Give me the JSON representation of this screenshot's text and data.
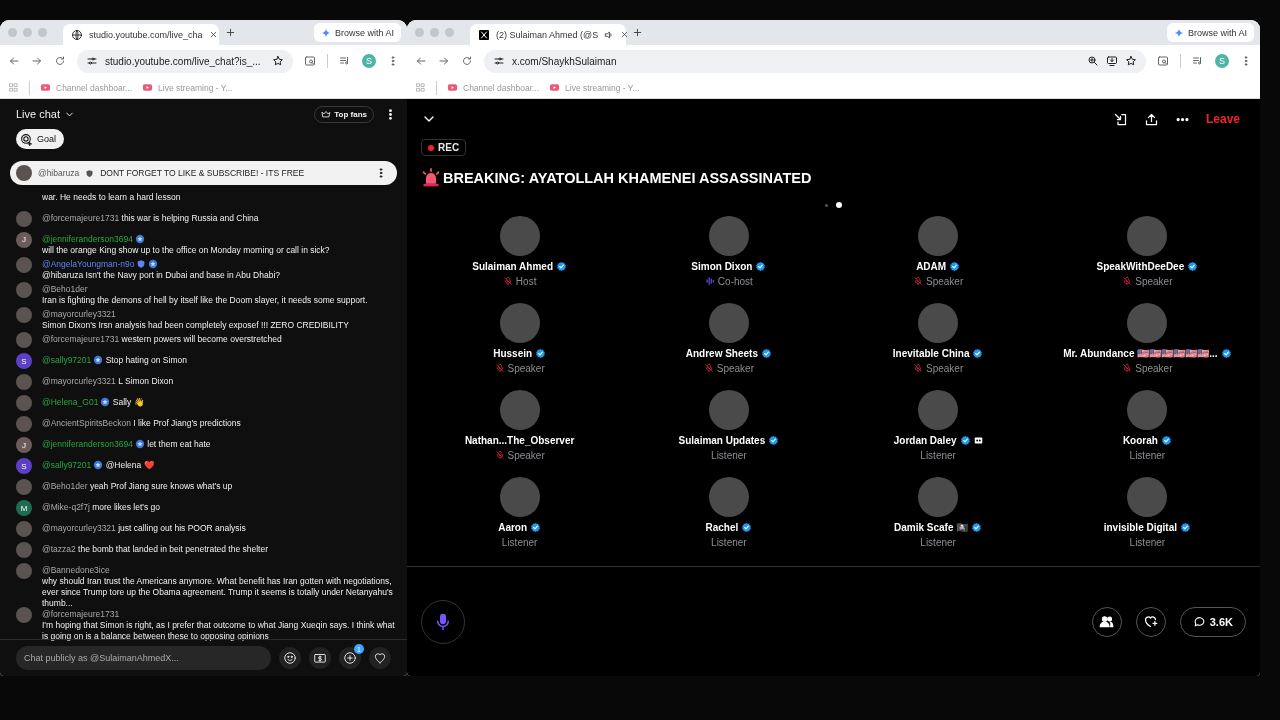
{
  "left_window": {
    "tab": {
      "kind": "globe",
      "title": "studio.youtube.com/live_cha",
      "audio": false
    },
    "browse_ai": "Browse with AI",
    "url": "studio.youtube.com/live_chat?is_...",
    "url_actions": [
      {
        "kind": "star"
      }
    ],
    "profile": "S",
    "bookmarks": [
      "Channel dashboar...",
      "Live streaming - Y..."
    ]
  },
  "live_chat": {
    "title": "Live chat",
    "top_fans": "Top fans",
    "goal": "Goal",
    "pinned": {
      "author": "@hibaruza",
      "text": "DONT FORGET TO LIKE & SUBSCRIBE! - ITS FREE"
    },
    "messages": [
      {
        "kind": "continuation",
        "text": "war. He needs to learn a hard lesson"
      },
      {
        "kind": "message",
        "avatar": {
          "kind": "photo"
        },
        "author": "@forcemajeure1731",
        "moderator": false,
        "member": false,
        "text": "this war is helping Russia and China"
      },
      {
        "kind": "message",
        "avatar": {
          "kind": "letter",
          "letter": "J",
          "color": "#6d5a5a"
        },
        "author": "@jenniferanderson3694",
        "moderator": false,
        "member": true,
        "text": "will the orange King show up to the office on Monday morning or call in sick?"
      },
      {
        "kind": "message",
        "avatar": {
          "kind": "photo"
        },
        "author": "@AngelaYoungman-n9o",
        "moderator": true,
        "member": true,
        "text": "@hibaruza Isn't the Navy port in Dubai and base in Abu Dhabi?"
      },
      {
        "kind": "message",
        "avatar": {
          "kind": "photo"
        },
        "author": "@Beho1der",
        "moderator": false,
        "member": false,
        "text": "Iran is fighting the demons of hell by itself like the Doom slayer, it needs some support."
      },
      {
        "kind": "message",
        "avatar": {
          "kind": "photo"
        },
        "author": "@mayorcurley3321",
        "moderator": false,
        "member": false,
        "text": "Simon Dixon's Irsn analysis had been completely exposef !!! ZERO CREDIBILITY"
      },
      {
        "kind": "message",
        "avatar": {
          "kind": "photo"
        },
        "author": "@forcemajeure1731",
        "moderator": false,
        "member": false,
        "text": "western powers will become overstretched"
      },
      {
        "kind": "message",
        "avatar": {
          "kind": "letter",
          "letter": "S",
          "color": "#5b3fc4"
        },
        "author": "@sally97201",
        "moderator": false,
        "member": true,
        "text": "Stop hating on Simon"
      },
      {
        "kind": "message",
        "avatar": {
          "kind": "photo"
        },
        "author": "@mayorcurley3321",
        "moderator": false,
        "member": false,
        "text": "L Simon Dixon"
      },
      {
        "kind": "message",
        "avatar": {
          "kind": "photo"
        },
        "author": "@Helena_G01",
        "moderator": false,
        "member": true,
        "text": "Sally 👋"
      },
      {
        "kind": "message",
        "avatar": {
          "kind": "photo"
        },
        "author": "@AncientSpiritsBeckon",
        "moderator": false,
        "member": false,
        "text": "I like Prof Jiang's predictions"
      },
      {
        "kind": "message",
        "avatar": {
          "kind": "letter",
          "letter": "J",
          "color": "#6d5a5a"
        },
        "author": "@jenniferanderson3694",
        "moderator": false,
        "member": true,
        "text": "let them eat hate"
      },
      {
        "kind": "message",
        "avatar": {
          "kind": "letter",
          "letter": "S",
          "color": "#5b3fc4"
        },
        "author": "@sally97201",
        "moderator": false,
        "member": true,
        "text": "@Helena ❤️"
      },
      {
        "kind": "message",
        "avatar": {
          "kind": "photo"
        },
        "author": "@Beho1der",
        "moderator": false,
        "member": false,
        "text": "yeah Prof Jiang sure knows what's up"
      },
      {
        "kind": "message",
        "avatar": {
          "kind": "letter",
          "letter": "M",
          "color": "#1e6b52"
        },
        "author": "@Mike-q2f7j",
        "moderator": false,
        "member": false,
        "text": "more likes let's go"
      },
      {
        "kind": "message",
        "avatar": {
          "kind": "photo"
        },
        "author": "@mayorcurley3321",
        "moderator": false,
        "member": false,
        "text": "just calling out his POOR analysis"
      },
      {
        "kind": "message",
        "avatar": {
          "kind": "photo"
        },
        "author": "@tazza2",
        "moderator": false,
        "member": false,
        "text": "the bomb that landed in beit penetrated the shelter"
      },
      {
        "kind": "message",
        "avatar": {
          "kind": "photo"
        },
        "author": "@Bannedone3ice",
        "moderator": false,
        "member": false,
        "text": "why should Iran trust the Americans anymore. What benefit has Iran gotten with negotiations, ever since Trump tore up the Obama agreement. Trump it seems is totally under Netanyahu's thumb..."
      },
      {
        "kind": "message",
        "avatar": {
          "kind": "photo"
        },
        "author": "@forcemajeure1731",
        "moderator": false,
        "member": false,
        "text": "I'm hoping that Simon is right, as I prefer that outcome to what Jiang Xueqin says. I think what is going on is a balance between these to opposing opinions"
      }
    ],
    "input": {
      "placeholder": "Chat publicly as @SulaimanAhmedX...",
      "plus_badge": "1"
    }
  },
  "right_window": {
    "tab": {
      "kind": "x",
      "title": "(2) Sulaiman Ahmed (@S",
      "audio": true
    },
    "browse_ai": "Browse with AI",
    "url": "x.com/ShaykhSulaiman",
    "url_actions": [
      {
        "kind": "zoom"
      },
      {
        "kind": "install"
      },
      {
        "kind": "star"
      }
    ],
    "profile": "S",
    "bookmarks": [
      "Channel dashboar...",
      "Live streaming - Y..."
    ]
  },
  "space": {
    "leave": "Leave",
    "rec": "REC",
    "title": "BREAKING: AYATOLLAH KHAMENEI ASSASSINATED",
    "pages": [
      {
        "selected": false
      },
      {
        "selected": true
      }
    ],
    "participants": [
      {
        "kind": "muted",
        "name": "Sulaiman Ahmed",
        "verified": true,
        "badge": false,
        "role": "Host"
      },
      {
        "kind": "speaking",
        "name": "Simon Dixon",
        "verified": true,
        "badge": false,
        "role": "Co-host"
      },
      {
        "kind": "muted",
        "name": "ADAM",
        "verified": true,
        "badge": false,
        "role": "Speaker"
      },
      {
        "kind": "muted",
        "name": "SpeakWithDeeDee",
        "verified": true,
        "badge": false,
        "role": "Speaker"
      },
      {
        "kind": "muted",
        "name": "Hussein",
        "verified": true,
        "badge": false,
        "role": "Speaker"
      },
      {
        "kind": "muted",
        "name": "Andrew Sheets",
        "verified": true,
        "badge": false,
        "role": "Speaker"
      },
      {
        "kind": "muted",
        "name": "Inevitable China",
        "verified": true,
        "badge": false,
        "role": "Speaker"
      },
      {
        "kind": "muted",
        "name": "Mr. Abundance 🇺🇸🇺🇸🇺🇸🇺🇸🇺🇸🇺🇸...",
        "verified": true,
        "badge": false,
        "role": "Speaker"
      },
      {
        "kind": "muted",
        "name": "Nathan...The_Observer",
        "verified": false,
        "badge": false,
        "role": "Speaker"
      },
      {
        "kind": "listener",
        "name": "Sulaiman Updates",
        "verified": true,
        "badge": false,
        "role": "Listener"
      },
      {
        "kind": "listener",
        "name": "Jordan Daley",
        "verified": true,
        "badge": true,
        "role": "Listener"
      },
      {
        "kind": "listener",
        "name": "Koorah",
        "verified": true,
        "badge": false,
        "role": "Listener"
      },
      {
        "kind": "listener",
        "name": "Aaron",
        "verified": true,
        "badge": false,
        "role": "Listener"
      },
      {
        "kind": "listener",
        "name": "Rachel",
        "verified": true,
        "badge": false,
        "role": "Listener"
      },
      {
        "kind": "listener",
        "name": "Damik Scafe 🏴‍☠️",
        "verified": true,
        "badge": false,
        "role": "Listener"
      },
      {
        "kind": "listener",
        "name": "invisible Digital",
        "verified": true,
        "badge": false,
        "role": "Listener"
      }
    ],
    "comments": "3.6K"
  }
}
